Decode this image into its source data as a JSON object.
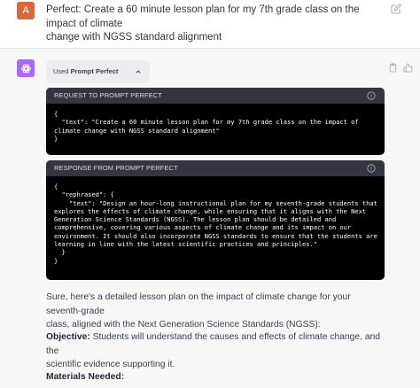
{
  "user": {
    "avatar_letter": "A",
    "message_line1": "Perfect: Create a 60 minute lesson plan for my 7th grade class on the impact of climate",
    "message_line2": "change with NGSS standard alignment"
  },
  "assistant": {
    "plugin": {
      "used_label": "Used",
      "plugin_name": "Prompt Perfect"
    },
    "request": {
      "header": "REQUEST TO PROMPT PERFECT",
      "code": "{\n  \"text\": \"Create a 60 minute lesson plan for my 7th grade class on the impact of\nclimate change with NGSS standard alignment\"\n}"
    },
    "response": {
      "header": "RESPONSE FROM PROMPT PERFECT",
      "code": "{\n  \"rephrased\": {\n    \"text\": \"Design an hour-long instructional plan for my seventh-grade students that\nexplores the effects of climate change, while ensuring that it aligns with the Next\nGeneration Science Standards (NGSS). The lesson plan should be detailed and\ncomprehensive, covering various aspects of climate change and its impact on our\nenvironment. It should also incorporate NGSS standards to ensure that the students are\nlearning in line with the latest scientific practices and principles.\"\n  }\n}"
    },
    "answer": {
      "intro_line1": "Sure, here's a detailed lesson plan on the impact of climate change for your seventh-grade",
      "intro_line2": "class, aligned with the Next Generation Science Standards (NGSS):",
      "objective_label": "Objective:",
      "objective_line1": " Students will understand the causes and effects of climate change, and the",
      "objective_line2": "scientific evidence supporting it.",
      "materials_label": "Materials Needed:"
    }
  },
  "colors": {
    "user_avatar": "#d9683f",
    "assistant_avatar": "#ab68ff",
    "code_header_bg": "#343541",
    "code_bg": "#000000"
  },
  "icons": [
    "edit-icon",
    "openai-logo-icon",
    "clipboard-icon",
    "thumbs-up-icon",
    "chevron-up-icon",
    "info-icon"
  ]
}
